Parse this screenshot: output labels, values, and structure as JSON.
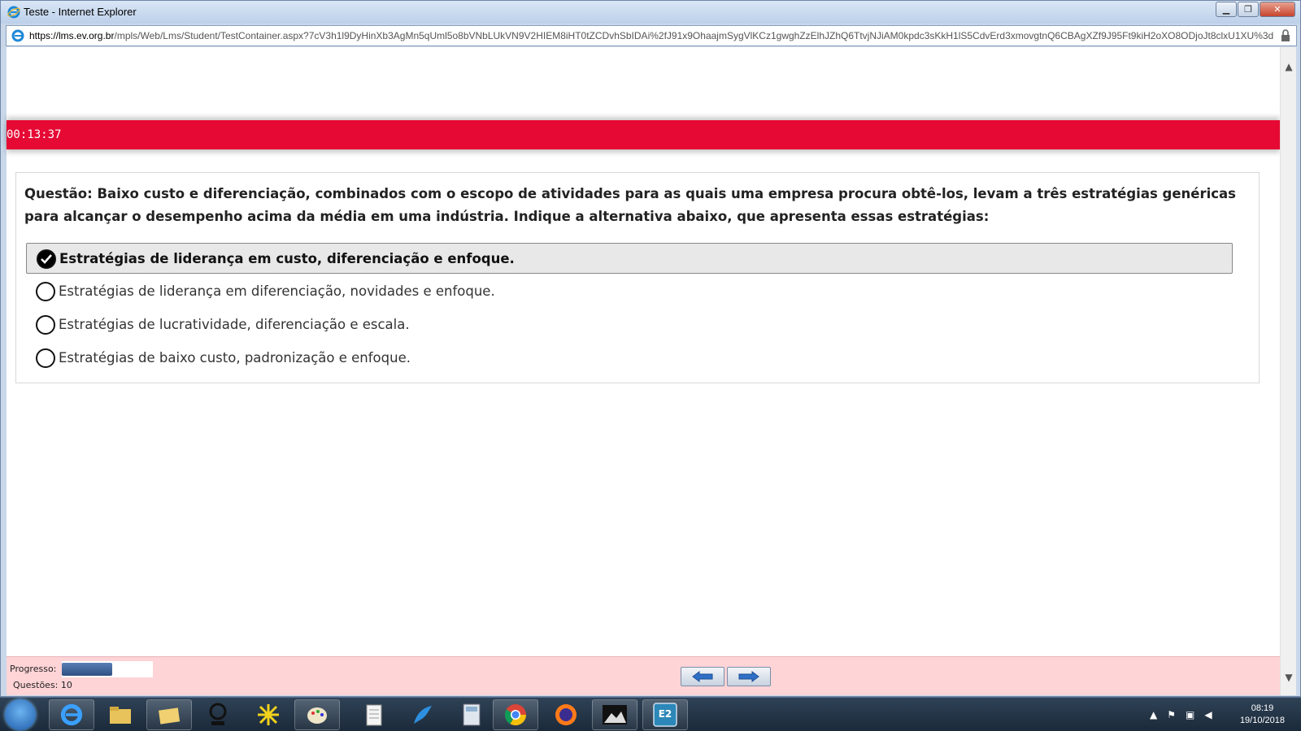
{
  "window": {
    "title": "Teste - Internet Explorer",
    "address_host": "https://lms.ev.org.br",
    "address_path": "/mpls/Web/Lms/Student/TestContainer.aspx?7cV3h1l9DyHinXb3AgMn5qUml5o8bVNbLUkVN9V2HIEM8iHT0tZCDvhSbIDAi%2fJ91x9OhaajmSygVlKCz1gwghZzElhJZhQ6TtvjNJiAM0kpdc3sKkH1lS5CdvErd3xmovgtnQ6CBAgXZf9J95Ft9kiH2oXO8ODjoJt8clxU1XU%3d"
  },
  "timer": {
    "value": "00:13:37"
  },
  "question": {
    "text": "Questão: Baixo custo e diferenciação, combinados com o escopo de atividades para as quais uma empresa procura obtê-los, levam a três estratégias genéricas para alcançar o desempenho acima da média em uma indústria. Indique a alternativa abaixo, que apresenta essas estratégias:",
    "options": [
      {
        "label": "Estratégias de liderança em custo, diferenciação e enfoque.",
        "selected": true
      },
      {
        "label": "Estratégias de liderança em diferenciação, novidades e enfoque.",
        "selected": false
      },
      {
        "label": "Estratégias de lucratividade, diferenciação e escala.",
        "selected": false
      },
      {
        "label": "Estratégias de baixo custo, padronização e enfoque.",
        "selected": false
      }
    ]
  },
  "footer": {
    "progress_label": "Progresso:",
    "progress_fraction": 0.55,
    "questions_label": "Questões: 10"
  },
  "taskbar": {
    "items": [
      "start-icon",
      "internet-explorer-icon",
      "file-explorer-icon",
      "folder-icon",
      "elo-app-icon",
      "snowflake-app-icon",
      "paint-icon",
      "notepad-icon",
      "bird-app-icon",
      "calculator-icon",
      "chrome-icon",
      "firefox-icon",
      "photo-app-icon",
      "e2-com-icon"
    ],
    "clock_time": "08:19",
    "clock_date": "19/10/2018"
  },
  "colors": {
    "timer_bar": "#e50934",
    "footer_bg": "#ffd4d7",
    "progress_fill": "#2f4f82"
  }
}
